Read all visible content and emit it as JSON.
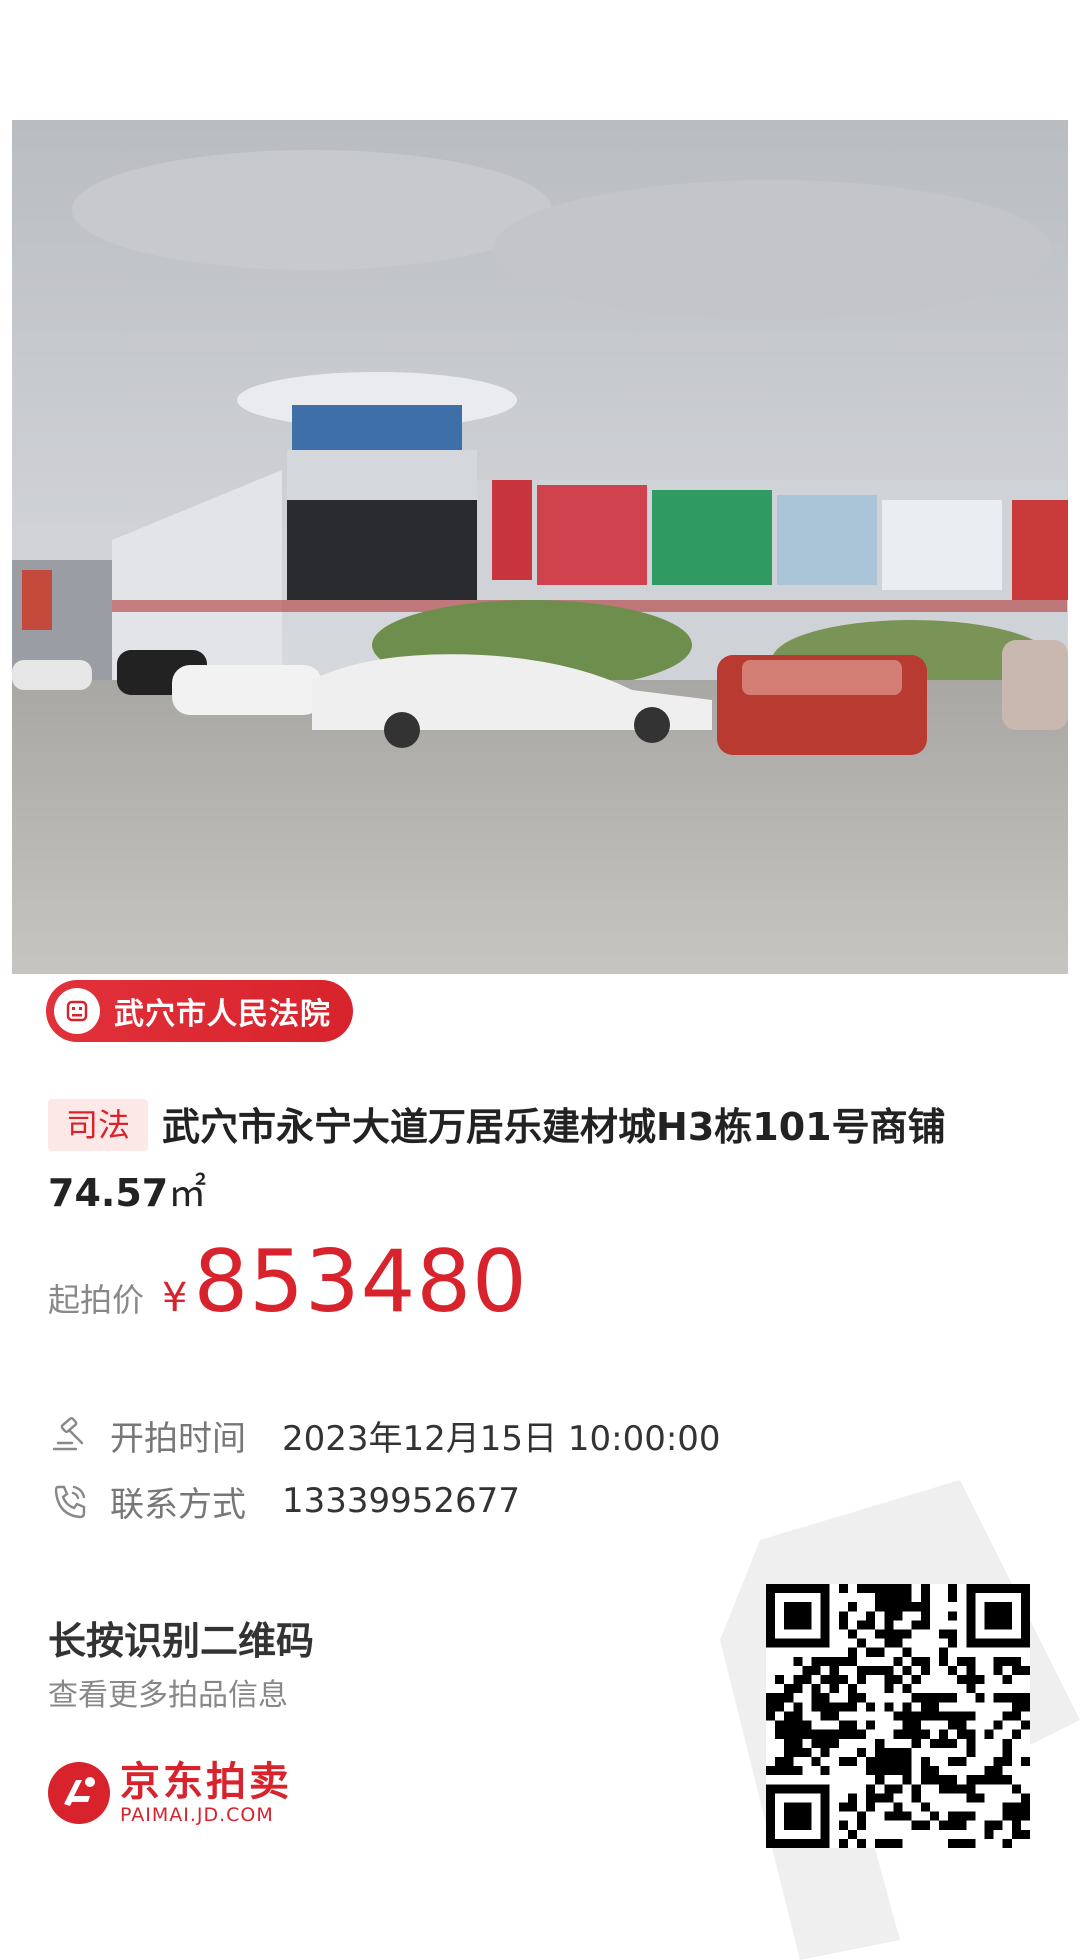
{
  "photo": {
    "description_icon": "building-photo"
  },
  "court": {
    "name": "武穴市人民法院",
    "icon": "court-icon"
  },
  "item": {
    "tag": "司法",
    "title_main": "武穴市永宁大道万居乐建材城H3栋101号商铺 74.57",
    "title_unit": "㎡"
  },
  "price": {
    "label": "起拍价",
    "currency": "¥",
    "value": "853480"
  },
  "info": {
    "start_time_label": "开拍时间",
    "start_time_value": "2023年12月15日 10:00:00",
    "contact_label": "联系方式",
    "contact_value": "13339952677"
  },
  "qr_hint": {
    "title": "长按识别二维码",
    "subtitle": "查看更多拍品信息"
  },
  "brand": {
    "name_cn": "京东拍卖",
    "name_en": "PAIMAI.JD.COM"
  },
  "colors": {
    "accent": "#d8232c",
    "tag_bg": "#fde8e8"
  }
}
